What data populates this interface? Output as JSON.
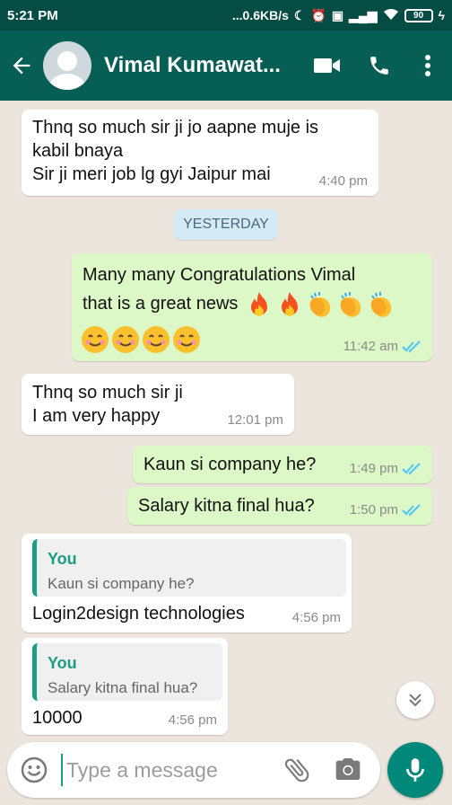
{
  "status_bar": {
    "time": "5:21 PM",
    "network_speed": "...0.6KB/s",
    "battery_level": "90"
  },
  "header": {
    "contact_name": "Vimal Kumawat...",
    "icons": [
      "back-arrow-icon",
      "avatar",
      "video-call-icon",
      "phone-icon",
      "more-vert-icon"
    ]
  },
  "date_divider": "YESTERDAY",
  "messages": [
    {
      "direction": "in",
      "lines": [
        "Thnq so much sir ji jo aapne muje is",
        "kabil bnaya",
        "Sir ji meri job lg gyi Jaipur mai"
      ],
      "time": "4:40 pm"
    },
    {
      "direction": "out",
      "lines": [
        "Many many Congratulations Vimal",
        "that is a great news"
      ],
      "emojis_inline": [
        "fire",
        "fire",
        "clap",
        "clap",
        "clap"
      ],
      "emojis_row": [
        "smile",
        "smile",
        "smile",
        "smile"
      ],
      "time": "11:42 am",
      "ticks": "read"
    },
    {
      "direction": "in",
      "lines": [
        "Thnq so much sir ji",
        "I am very happy"
      ],
      "time": "12:01 pm"
    },
    {
      "direction": "out",
      "lines": [
        "Kaun si company he?"
      ],
      "time": "1:49 pm",
      "ticks": "read"
    },
    {
      "direction": "out",
      "lines": [
        "Salary kitna final hua?"
      ],
      "time": "1:50 pm",
      "ticks": "read"
    },
    {
      "direction": "in",
      "quote": {
        "author": "You",
        "text": "Kaun si company he?"
      },
      "lines": [
        "Login2design technologies"
      ],
      "time": "4:56 pm"
    },
    {
      "direction": "in",
      "quote": {
        "author": "You",
        "text": "Salary kitna final hua?"
      },
      "lines": [
        "10000"
      ],
      "time": "4:56 pm"
    }
  ],
  "composer": {
    "placeholder": "Type a message"
  },
  "colors": {
    "header": "#075e54",
    "status_bar": "#054d44",
    "outgoing_bubble": "#dcf8c6",
    "incoming_bubble": "#ffffff",
    "chat_background": "#ece5dd",
    "read_ticks": "#4fc3f7",
    "accent": "#1b9d83",
    "mic_button": "#00897b"
  }
}
